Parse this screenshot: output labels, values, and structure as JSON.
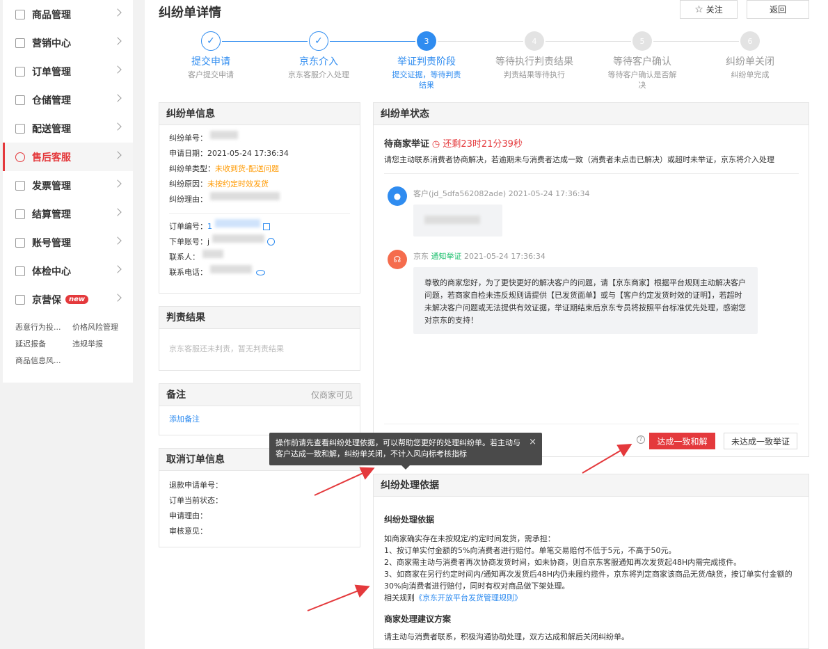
{
  "sidebar": {
    "items": [
      {
        "label": "商品管理",
        "icon": "bag-icon"
      },
      {
        "label": "营销中心",
        "icon": "chart-icon"
      },
      {
        "label": "订单管理",
        "icon": "order-icon"
      },
      {
        "label": "仓储管理",
        "icon": "warehouse-icon"
      },
      {
        "label": "配送管理",
        "icon": "truck-icon"
      },
      {
        "label": "售后客服",
        "icon": "headset-icon",
        "active": true
      },
      {
        "label": "发票管理",
        "icon": "invoice-icon"
      },
      {
        "label": "结算管理",
        "icon": "settlement-icon"
      },
      {
        "label": "账号管理",
        "icon": "account-icon"
      },
      {
        "label": "体检中心",
        "icon": "checkup-icon"
      },
      {
        "label": "京营保",
        "icon": "shield-icon",
        "badge": "new"
      }
    ],
    "sub_links": [
      "恶意行为投...",
      "价格风险管理",
      "延迟报备",
      "违规举报",
      "商品信息风..."
    ]
  },
  "header": {
    "title": "纠纷单详情",
    "follow_label": "关注",
    "back_label": "返回"
  },
  "steps": [
    {
      "num": "1",
      "title": "提交申请",
      "desc": "客户提交申请",
      "state": "done"
    },
    {
      "num": "2",
      "title": "京东介入",
      "desc": "京东客服介入处理",
      "state": "done"
    },
    {
      "num": "3",
      "title": "举证判责阶段",
      "desc": "提交证据，等待判责结果",
      "state": "current"
    },
    {
      "num": "4",
      "title": "等待执行判责结果",
      "desc": "判责结果等待执行",
      "state": "todo"
    },
    {
      "num": "5",
      "title": "等待客户确认",
      "desc": "等待客户确认是否解决",
      "state": "todo"
    },
    {
      "num": "6",
      "title": "纠纷单关闭",
      "desc": "纠纷单完成",
      "state": "todo"
    }
  ],
  "dispute_info": {
    "title": "纠纷单信息",
    "rows": [
      {
        "k": "纠纷单号：",
        "v": ""
      },
      {
        "k": "申请日期：",
        "v": "2021-05-24 17:36:34"
      },
      {
        "k": "纠纷单类型：",
        "v": "未收到货-配送问题"
      },
      {
        "k": "纠纷原因：",
        "v": "未按约定时效发货"
      },
      {
        "k": "纠纷理由：",
        "v": ""
      }
    ],
    "rows2": [
      {
        "k": "订单编号：",
        "v": "1"
      },
      {
        "k": "下单账号：",
        "v": "j"
      },
      {
        "k": "联系人：",
        "v": ""
      },
      {
        "k": "联系电话：",
        "v": ""
      }
    ]
  },
  "judgment": {
    "title": "判责结果",
    "empty": "京东客服还未判责，暂无判责结果"
  },
  "notes": {
    "title": "备注",
    "visibility": "仅商家可见",
    "add_label": "添加备注"
  },
  "cancel_info": {
    "title": "取消订单信息",
    "rows": [
      "退款申请单号：",
      "订单当前状态：",
      "申请理由：",
      "审核意见："
    ]
  },
  "status": {
    "title": "纠纷单状态",
    "state": "待商家举证",
    "countdown": "还剩23时21分39秒",
    "desc": "请您主动联系消费者协商解决，若逾期未与消费者达成一致（消费者未点击已解决）或超时未举证，京东将介入处理",
    "msg1_meta": "客户(jd_5dfa562082ade) 2021-05-24 17:36:34",
    "msg2_sender": "京东",
    "msg2_tag": "通知举证",
    "msg2_time": "2021-05-24 17:36:34",
    "msg2_text": "尊敬的商家您好，为了更快更好的解决客户的问题，请【京东商家】根据平台规则主动解决客户问题，若商家自检未违反规则请提供【已发货面单】或与【客户约定发货时效的证明】，若超时未解决客户问题或无法提供有效证据，举证期结束后京东专员将按照平台标准优先处理，感谢您对京东的支持！",
    "agree_label": "达成一致和解",
    "disagree_label": "未达成一致举证"
  },
  "tooltip": {
    "text": "操作前请先查看纠纷处理依据，可以帮助您更好的处理纠纷单。若主动与客户达成一致和解，纠纷单关闭，不计入风向标考核指标",
    "close": "×"
  },
  "basis": {
    "title": "纠纷处理依据",
    "h1": "纠纷处理依据",
    "lines": [
      "如商家确实存在未按规定/约定时间发货，需承担：",
      "1、按订单实付金额的5%向消费者进行赔付。单笔交易赔付不低于5元，不高于50元。",
      "2、商家需主动与消费者再次协商发货时间，如未协商，则自京东客服通知再次发货起48H内需完成揽件。",
      "3、如商家在另行约定时间内/通知再次发货后48H内仍未履约揽件，京东将判定商家该商品无货/缺货，按订单实付金额的30%向消费者进行赔付，同时有权对商品做下架处理。"
    ],
    "rule_prefix": "相关规则",
    "rule_link": "《京东开放平台发货管理规则》",
    "h2": "商家处理建议方案",
    "suggest": "请主动与消费者联系，积极沟通协助处理，双方达成和解后关闭纠纷单。"
  },
  "colors": {
    "accent": "#e4393c",
    "step_blue": "#2f8cf0",
    "warning": "#f90"
  }
}
